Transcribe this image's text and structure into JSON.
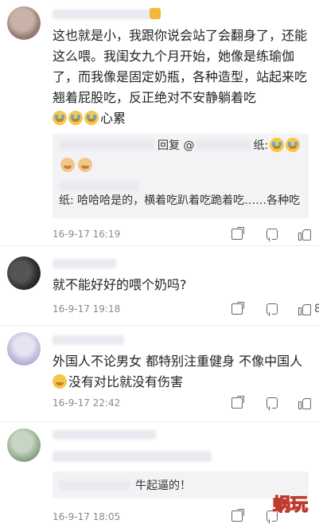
{
  "comments": [
    {
      "text": "这也就是小，我跟你说会站了会翻身了，还能这么喂。我闺女九个月开始，她像是练瑜伽了，而我像是固定奶瓶，各种造型，站起来吃翘着屁股吃，反正绝对不安静躺着吃",
      "emoji_tail": "心累",
      "quotes": [
        {
          "label": "回复 @",
          "suffix": "纸:"
        },
        {
          "suffix": "纸: 哈哈哈是的，横着吃趴着吃跪着吃……各种吃"
        }
      ],
      "time": "16-9-17 16:19",
      "likes": ""
    },
    {
      "text": "就不能好好的喂个奶吗?",
      "time": "16-9-17 19:18",
      "likes": "8"
    },
    {
      "text_a": "外国人不论男女 都特别注重健身 不像中国人",
      "text_b": "没有对比就没有伤害",
      "time": "16-9-17 22:42",
      "likes": ""
    },
    {
      "reply_text": "牛起逼的！",
      "time": "16-9-17 18:05",
      "likes": ""
    }
  ],
  "watermark": {
    "text": "蜗玩"
  },
  "colors": {
    "accent": "#f6c64a",
    "muted": "#8a8a8a",
    "quote_bg": "#f3f3f6"
  }
}
